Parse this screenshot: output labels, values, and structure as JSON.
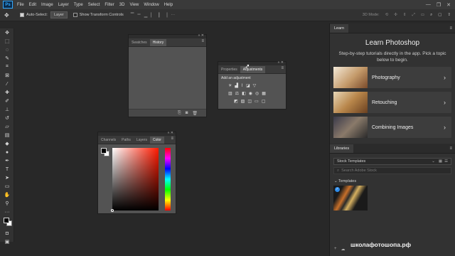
{
  "menubar": {
    "logo": "Ps",
    "items": [
      "File",
      "Edit",
      "Image",
      "Layer",
      "Type",
      "Select",
      "Filter",
      "3D",
      "View",
      "Window",
      "Help"
    ],
    "window_controls": [
      "—",
      "❐",
      "✕"
    ]
  },
  "options_bar": {
    "auto_select_label": "Auto-Select:",
    "auto_select_checked": true,
    "layer_dropdown": "Layer",
    "show_transform_label": "Show Transform Controls",
    "show_transform_checked": false,
    "mode_3d_label": "3D Mode:"
  },
  "toolbar": {
    "tools": [
      "move",
      "marquee",
      "lasso",
      "quick-select",
      "crop",
      "frame",
      "eyedropper",
      "healing",
      "brush",
      "stamp",
      "history-brush",
      "eraser",
      "gradient",
      "blur",
      "dodge",
      "pen",
      "type",
      "path-select",
      "rectangle",
      "hand",
      "zoom",
      "more"
    ]
  },
  "swatches_history_panel": {
    "tabs": [
      "Swatches",
      "History"
    ],
    "active_tab": "History"
  },
  "properties_adjustments_panel": {
    "tabs": [
      "Properties",
      "Adjustments"
    ],
    "active_tab": "Adjustments",
    "heading": "Add an adjustment"
  },
  "color_panel": {
    "tabs": [
      "Channels",
      "Paths",
      "Layers",
      "Color"
    ],
    "active_tab": "Color",
    "hue_color": "#ff1a00"
  },
  "learn_panel": {
    "tab": "Learn",
    "title": "Learn Photoshop",
    "description": "Step-by-step tutorials directly in the app. Pick a topic below to begin.",
    "topics": [
      {
        "label": "Photography"
      },
      {
        "label": "Retouching"
      },
      {
        "label": "Combining Images"
      }
    ]
  },
  "libraries_panel": {
    "tab": "Libraries",
    "library_select": "Stock Templates",
    "search_placeholder": "Search Adobe Stock",
    "section": "Templates"
  },
  "watermark": "школафотошопа.рф"
}
